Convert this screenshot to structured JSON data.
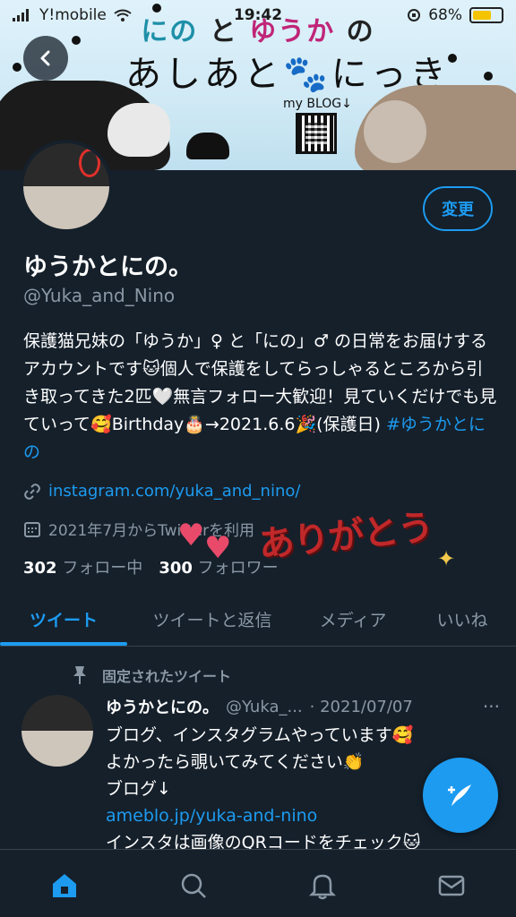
{
  "status_bar": {
    "carrier": "Y!mobile",
    "time": "19:42",
    "battery": "68%",
    "battery_level": 0.68
  },
  "banner": {
    "title_part1": "にの",
    "title_part2": "と",
    "title_part3": "ゆうか",
    "title_part4": "の",
    "subtitle": "あしあと🐾にっき",
    "blog_label": "my BLOG↓"
  },
  "profile": {
    "edit_button": "変更",
    "display_name": "ゆうかとにの。",
    "handle": "@Yuka_and_Nino",
    "bio_text": "保護猫兄妹の「ゆうか」♀ と「にの」♂ の日常をお届けするアカウントです🐱個人で保護をしてらっしゃるところから引き取ってきた2匹🤍無言フォロー大歓迎！見ていくだけでも見ていって🥰Birthday🎂→2021.6.6🎉(保護日) ",
    "bio_hashtag": "#ゆうかとにの",
    "link": "instagram.com/yuka_and_nino/",
    "joined": "2021年7月からTwitterを利用",
    "following_count": "302",
    "following_label": "フォロー中",
    "followers_count": "300",
    "followers_label": "フォロワー",
    "overlay_text": "ありがとう"
  },
  "tabs": [
    {
      "label": "ツイート",
      "active": true
    },
    {
      "label": "ツイートと返信",
      "active": false
    },
    {
      "label": "メディア",
      "active": false
    },
    {
      "label": "いいね",
      "active": false
    }
  ],
  "tweet": {
    "pinned_label": "固定されたツイート",
    "name": "ゆうかとにの。",
    "handle": "@Yuka_...",
    "date": "· 2021/07/07",
    "more": "···",
    "line1": "ブログ、インスタグラムやっています🥰",
    "line2": "よかったら覗いてみてください👏",
    "line3": "ブログ↓",
    "link": "ameblo.jp/yuka-and-nino",
    "line4": "インスタは画像のQRコードをチェック🐱"
  },
  "icons": [
    "back-icon",
    "link-icon",
    "calendar-icon",
    "pin-icon",
    "compose-icon",
    "home-icon",
    "search-icon",
    "bell-icon",
    "mail-icon"
  ],
  "colors": {
    "accent": "#1d9bf0",
    "background": "#15202b",
    "muted": "#8b98a5"
  }
}
